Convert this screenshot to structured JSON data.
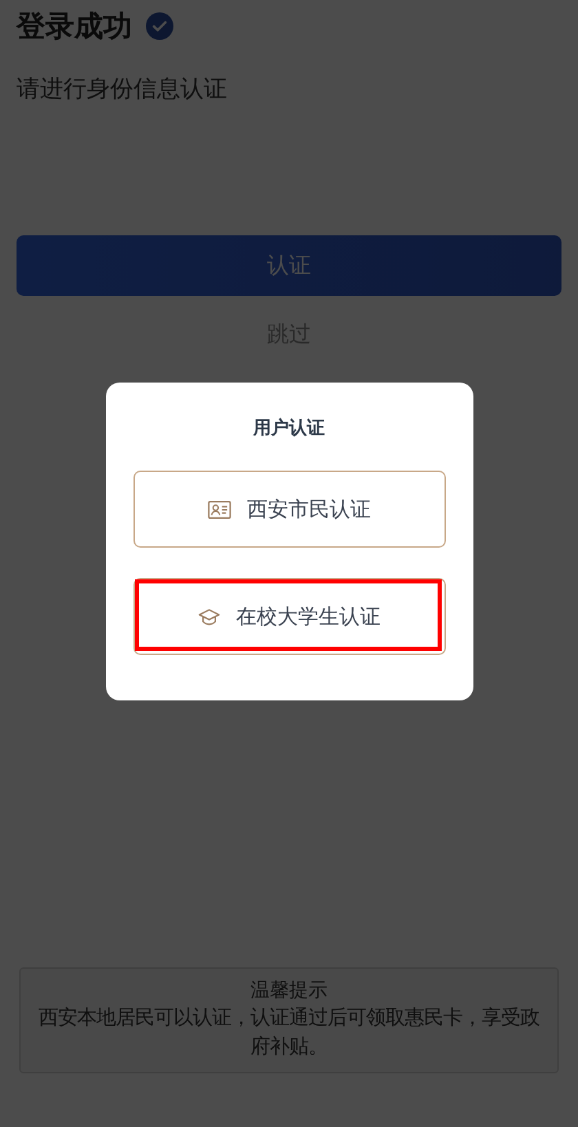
{
  "page": {
    "title": "登录成功",
    "verified": true,
    "subtitle": "请进行身份信息认证",
    "primary_button": "认证",
    "skip_link": "跳过"
  },
  "dialog": {
    "title": "用户认证",
    "options": [
      {
        "kind": "citizen",
        "label": "西安市民认证",
        "highlighted": false
      },
      {
        "kind": "student",
        "label": "在校大学生认证",
        "highlighted": true
      }
    ]
  },
  "notice": {
    "title": "温馨提示",
    "text": "西安本地居民可以认证，认证通过后可领取惠民卡，享受政府补贴。"
  }
}
